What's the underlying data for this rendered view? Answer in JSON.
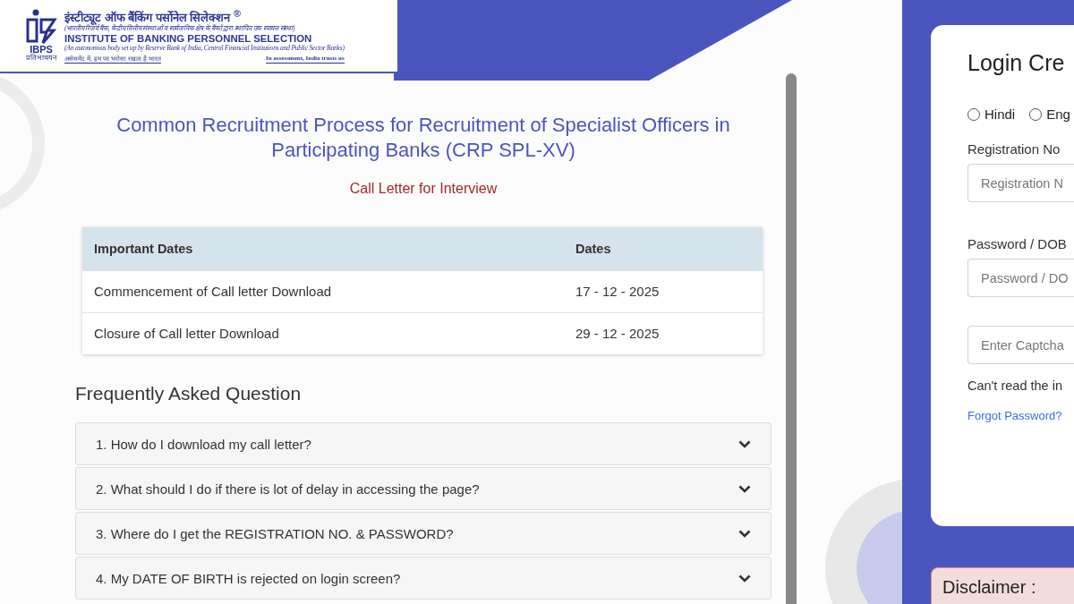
{
  "logo": {
    "mark": "IBPS",
    "mark_sub": "प्रतिभाचयन",
    "hindi_name": "इंस्टीट्यूट ऑफ बैंकिंग पर्सोनेल सिलेक्शन",
    "registered": "®",
    "hindi_sub": "(भारतीय रिज़र्व बैंक, केंद्रीय वित्तीय संस्थाओं व सार्वजनिक क्षेत्र के बैंकों द्वारा स्थापित एक स्वायत्त संस्था)",
    "english_name": "INSTITUTE OF BANKING PERSONNEL SELECTION",
    "english_sub": "(An autonomous body set up by Reserve Bank of India, Central Financial Institutions and Public Sector Banks)",
    "hindi_tagline": "असेसमेंट में, हम पर भरोसा रखता है भारत",
    "english_tagline": "In assessment, India trusts us"
  },
  "title": "Common Recruitment Process for Recruitment of Specialist Officers in Participating Banks (CRP SPL-XV)",
  "subtitle": "Call Letter for Interview",
  "dates_table": {
    "columns": [
      "Important Dates",
      "Dates"
    ],
    "rows": [
      [
        "Commencement of Call letter Download",
        "17 - 12 - 2025"
      ],
      [
        "Closure of Call letter Download",
        "29 - 12 - 2025"
      ]
    ]
  },
  "faq": {
    "heading": "Frequently Asked Question",
    "items": [
      {
        "question": "1. How do I download my call letter?",
        "expanded": false
      },
      {
        "question": "2. What should I do if there is lot of delay in accessing the page?",
        "expanded": false
      },
      {
        "question": "3. Where do I get the REGISTRATION NO. & PASSWORD?",
        "expanded": false
      },
      {
        "question": "4. My DATE OF BIRTH is rejected on login screen?",
        "expanded": false
      }
    ]
  },
  "login": {
    "title": "Login Cre",
    "languages": [
      {
        "label": "Hindi",
        "selected": false
      },
      {
        "label": "Eng",
        "selected": false
      }
    ],
    "fields": [
      {
        "label": "Registration No",
        "placeholder": "Registration N"
      },
      {
        "label": "Password / DOB",
        "placeholder": "Password / DO"
      },
      {
        "placeholder": "Enter Captcha"
      }
    ],
    "captcha_hint": "Can't read the in",
    "forgot_link": "Forgot Password?"
  },
  "disclaimer": {
    "title": "Disclaimer :"
  }
}
